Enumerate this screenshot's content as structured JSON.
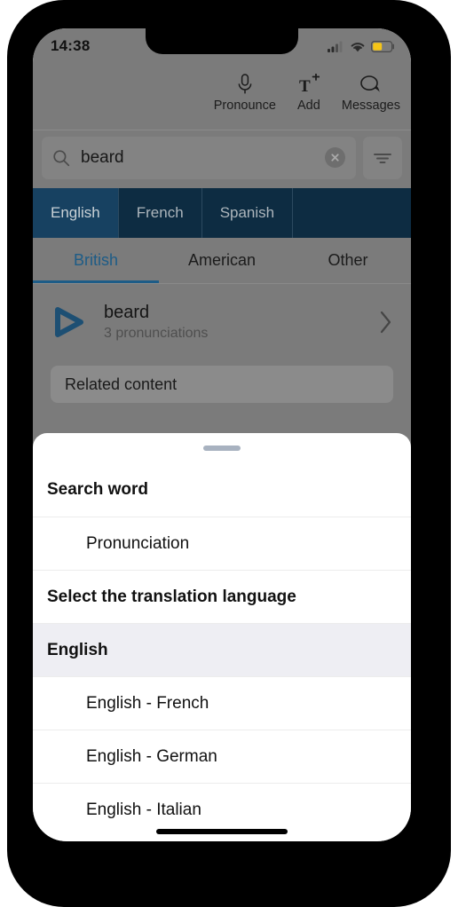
{
  "status_bar": {
    "time": "14:38",
    "icons": [
      "cellular-signal-icon",
      "wifi-icon",
      "battery-icon"
    ],
    "battery_color": "#f5c518"
  },
  "toolbar": {
    "items": [
      {
        "label": "Pronounce",
        "icon": "microphone-icon"
      },
      {
        "label": "Add",
        "icon": "add-text-icon"
      },
      {
        "label": "Messages",
        "icon": "messages-icon"
      }
    ]
  },
  "search": {
    "value": "beard",
    "placeholder": "Search",
    "search_icon": "search-icon",
    "clear_icon": "clear-icon",
    "filter_icon": "filter-icon"
  },
  "language_tabs": {
    "items": [
      "English",
      "French",
      "Spanish"
    ],
    "selected": "English",
    "bar_color": "#0d2c42",
    "selected_color": "#174161"
  },
  "variety_tabs": {
    "items": [
      "British",
      "American",
      "Other"
    ],
    "selected": "British",
    "accent_color": "#1d5c87"
  },
  "result": {
    "word": "beard",
    "subtitle": "3 pronunciations",
    "play_icon": "play-icon",
    "chevron_icon": "chevron-right-icon"
  },
  "related": {
    "label": "Related content"
  },
  "sheet": {
    "handle": "drag-handle",
    "rows": [
      {
        "label": "Search word",
        "style": "head"
      },
      {
        "label": "Pronunciation",
        "style": "indent"
      },
      {
        "label": "Select the translation language",
        "style": "sub-head"
      },
      {
        "label": "English",
        "style": "group"
      },
      {
        "label": "English - French",
        "style": "indent"
      },
      {
        "label": "English - German",
        "style": "indent"
      },
      {
        "label": "English - Italian",
        "style": "indent"
      }
    ]
  }
}
